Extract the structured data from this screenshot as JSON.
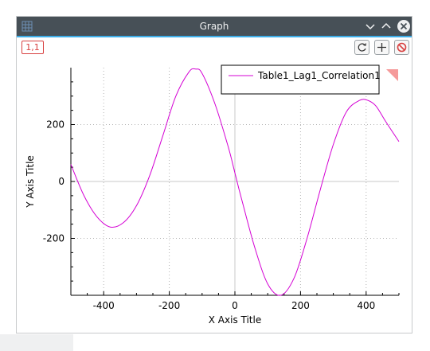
{
  "window": {
    "title": "Graph"
  },
  "layer_tag": "1,1",
  "toolbar": {
    "icons": [
      "rescale-icon",
      "add-layer-icon",
      "remove-layer-icon"
    ]
  },
  "colors": {
    "titlebar": "#475057",
    "accent": "#3daee9",
    "curve": "#d400d4",
    "layer_tag": "#d84040"
  },
  "chart_data": {
    "type": "line",
    "title": "",
    "xlabel": "X Axis Title",
    "ylabel": "Y Axis Title",
    "xlim": [
      -500,
      500
    ],
    "ylim": [
      -400,
      400
    ],
    "x_ticks": [
      "-400",
      "-200",
      "0",
      "200",
      "400"
    ],
    "y_ticks": [
      "200",
      "0",
      "-200"
    ],
    "x_tick_values": [
      -400,
      -200,
      0,
      200,
      400
    ],
    "y_tick_values": [
      200,
      0,
      -200
    ],
    "grid": true,
    "legend_position": "top-right",
    "series": [
      {
        "name": "Table1_Lag1_Correlation1",
        "x": [
          -500,
          -460,
          -420,
          -380,
          -340,
          -300,
          -260,
          -220,
          -180,
          -140,
          -120,
          -100,
          -60,
          -20,
          0,
          20,
          60,
          100,
          140,
          180,
          220,
          260,
          300,
          340,
          380,
          405,
          430,
          460,
          500
        ],
        "y": [
          60,
          -50,
          -125,
          -160,
          -145,
          -85,
          20,
          160,
          300,
          385,
          395,
          380,
          270,
          120,
          30,
          -60,
          -230,
          -360,
          -400,
          -340,
          -200,
          -30,
          130,
          245,
          285,
          285,
          265,
          210,
          140
        ]
      }
    ]
  }
}
